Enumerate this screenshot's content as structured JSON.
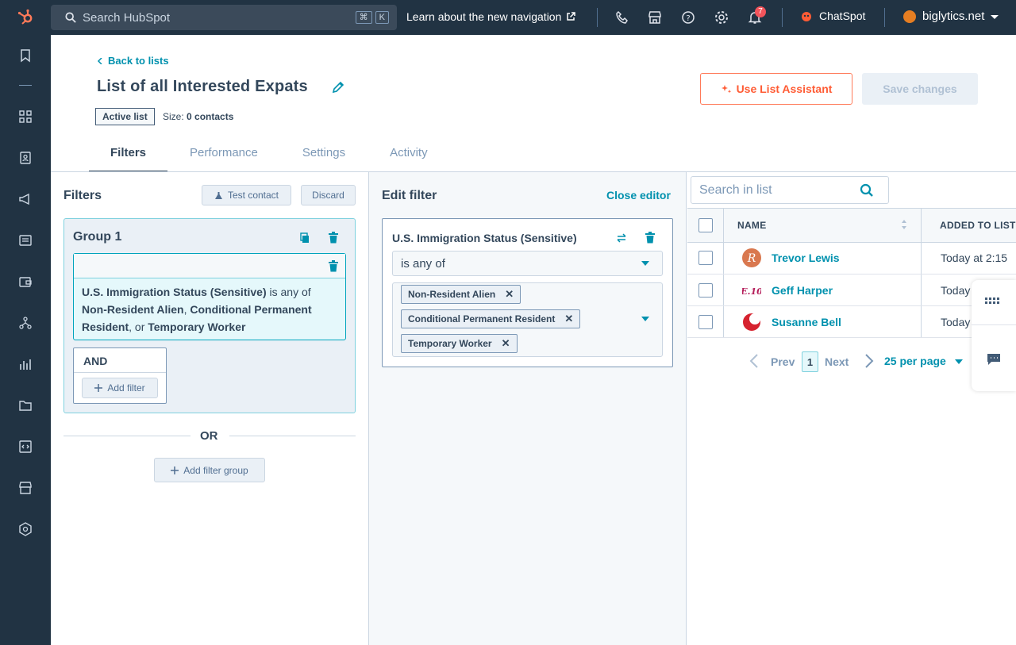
{
  "topbar": {
    "search_placeholder": "Search HubSpot",
    "shortcut_cmd": "⌘",
    "shortcut_key": "K",
    "learn_link": "Learn about the new navigation",
    "notification_count": "7",
    "chatspot_label": "ChatSpot",
    "account_name": "biglytics.net"
  },
  "header": {
    "back_link": "Back to lists",
    "title": "List of all Interested Expats",
    "list_type": "Active list",
    "size_label": "Size:",
    "size_value": "0 contacts",
    "assistant_button": "Use List Assistant",
    "save_button": "Save changes"
  },
  "tabs": [
    "Filters",
    "Performance",
    "Settings",
    "Activity"
  ],
  "filters_panel": {
    "heading": "Filters",
    "test_contact": "Test contact",
    "discard": "Discard",
    "group_title": "Group 1",
    "filter_property": "U.S. Immigration Status (Sensitive)",
    "filter_operator": "is any of",
    "value_1": "Non-Resident Alien",
    "sep_1": ",",
    "value_2": "Conditional Permanent Resident",
    "sep_2": ", or",
    "value_3": "Temporary Worker",
    "and_label": "AND",
    "add_filter": "Add filter",
    "or_label": "OR",
    "add_filter_group": "Add filter group"
  },
  "edit_panel": {
    "heading": "Edit filter",
    "close_editor": "Close editor",
    "property": "U.S. Immigration Status (Sensitive)",
    "operator": "is any of",
    "chips": [
      "Non-Resident Alien",
      "Conditional Permanent Resident",
      "Temporary Worker"
    ]
  },
  "list_panel": {
    "search_placeholder": "Search in list",
    "col_name": "NAME",
    "col_added": "ADDED TO LIST",
    "rows": [
      {
        "name": "Trevor Lewis",
        "added": "Today at 2:15",
        "avatar_color": "#d9784f"
      },
      {
        "name": "Geff Harper",
        "added": "Today",
        "avatar_color": "#b51f5b"
      },
      {
        "name": "Susanne Bell",
        "added": "Today",
        "avatar_color": "#d6232f"
      }
    ],
    "prev": "Prev",
    "page": "1",
    "next": "Next",
    "per_page": "25 per page"
  },
  "colors": {
    "accent": "#0091ae",
    "brand_orange": "#ff5c35",
    "nav_bg": "#213343"
  }
}
